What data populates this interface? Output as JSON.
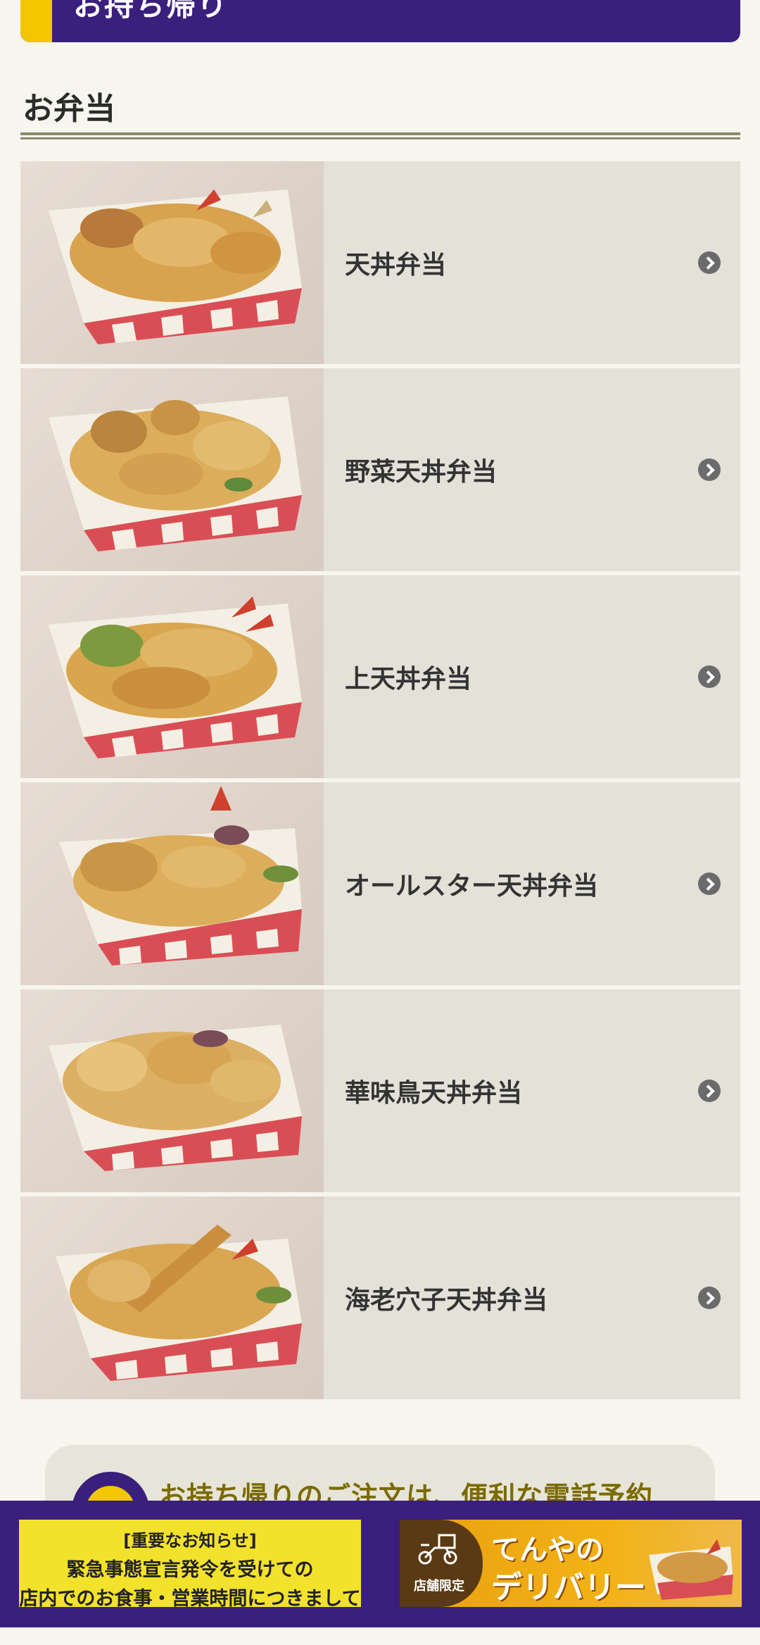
{
  "header": {
    "title": "お持ち帰り"
  },
  "section": {
    "heading": "お弁当"
  },
  "menu": {
    "items": [
      {
        "label": "天丼弁当"
      },
      {
        "label": "野菜天丼弁当"
      },
      {
        "label": "上天丼弁当"
      },
      {
        "label": "オールスター天丼弁当"
      },
      {
        "label": "華味鳥天丼弁当"
      },
      {
        "label": "海老穴子天丼弁当"
      }
    ]
  },
  "phone_card": {
    "text": "お持ち帰りのご注文は、便利な電話予約"
  },
  "footer": {
    "notice": {
      "line1": "[重要なお知らせ]",
      "line2": "緊急事態宣言発令を受けての",
      "line3": "店内でのお食事・営業時間につきまして"
    },
    "delivery": {
      "tag": "店舗限定",
      "brand_line1": "てんやの",
      "brand_line2": "デリバリー"
    }
  },
  "colors": {
    "brand_purple": "#3a1f7d",
    "accent_yellow": "#f2c700",
    "item_bg": "#e3e1d8",
    "page_bg": "#f7f6ee"
  }
}
